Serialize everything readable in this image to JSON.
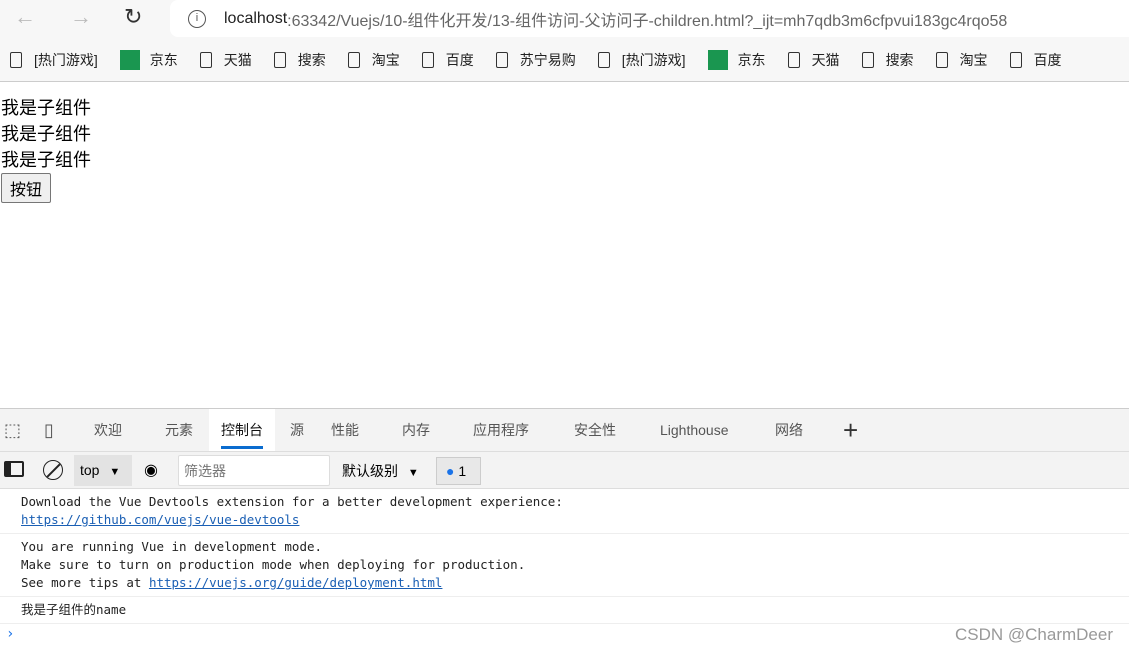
{
  "browser": {
    "url_host": "localhost",
    "url_rest": ":63342/Vuejs/10-组件化开发/13-组件访问-父访问子-children.html?_ijt=mh7qdb3m6cfpvui183gc4rqo58",
    "bookmarks": [
      "[热门游戏]",
      "京东",
      "天猫",
      "搜索",
      "淘宝",
      "百度",
      "苏宁易购",
      "[热门游戏]",
      "京东",
      "天猫",
      "搜索",
      "淘宝",
      "百度"
    ]
  },
  "page": {
    "lines": [
      "我是子组件",
      "我是子组件",
      "我是子组件"
    ],
    "button": "按钮"
  },
  "devtools": {
    "tabs": [
      "欢迎",
      "元素",
      "控制台",
      "源",
      "性能",
      "内存",
      "应用程序",
      "安全性",
      "Lighthouse",
      "网络"
    ],
    "context": "top",
    "filter_placeholder": "筛选器",
    "level": "默认级别",
    "message_count": "1",
    "logs": {
      "l1": "Download the Vue Devtools extension for a better development experience:",
      "l1link": "https://github.com/vuejs/vue-devtools",
      "l2a": "You are running Vue in development mode.",
      "l2b": "Make sure to turn on production mode when deploying for production.",
      "l2c": "See more tips at ",
      "l2link": "https://vuejs.org/guide/deployment.html",
      "l3": "我是子组件的name"
    }
  },
  "watermark": "CSDN @CharmDeer"
}
